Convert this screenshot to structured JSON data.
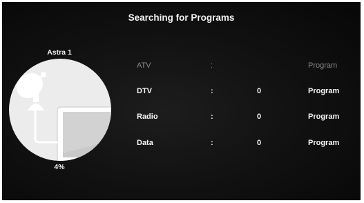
{
  "header": {
    "title": "Searching for Programs"
  },
  "satellite": {
    "name": "Astra 1",
    "progress_label": "4%",
    "progress_fraction": 0.04
  },
  "rows": [
    {
      "label": "ATV",
      "separator": ":",
      "count": "",
      "unit": "Program"
    },
    {
      "label": "DTV",
      "separator": ":",
      "count": "0",
      "unit": "Program"
    },
    {
      "label": "Radio",
      "separator": ":",
      "count": "0",
      "unit": "Program"
    },
    {
      "label": "Data",
      "separator": ":",
      "count": "0",
      "unit": "Program"
    }
  ],
  "icons": [
    "satellite-dish-icon",
    "tv-icon",
    "cable-icon"
  ],
  "colors": {
    "background": "#121212",
    "text": "#f2f2f2",
    "dim_text": "#8a8a8a",
    "illustration_bg": "#ededed"
  }
}
